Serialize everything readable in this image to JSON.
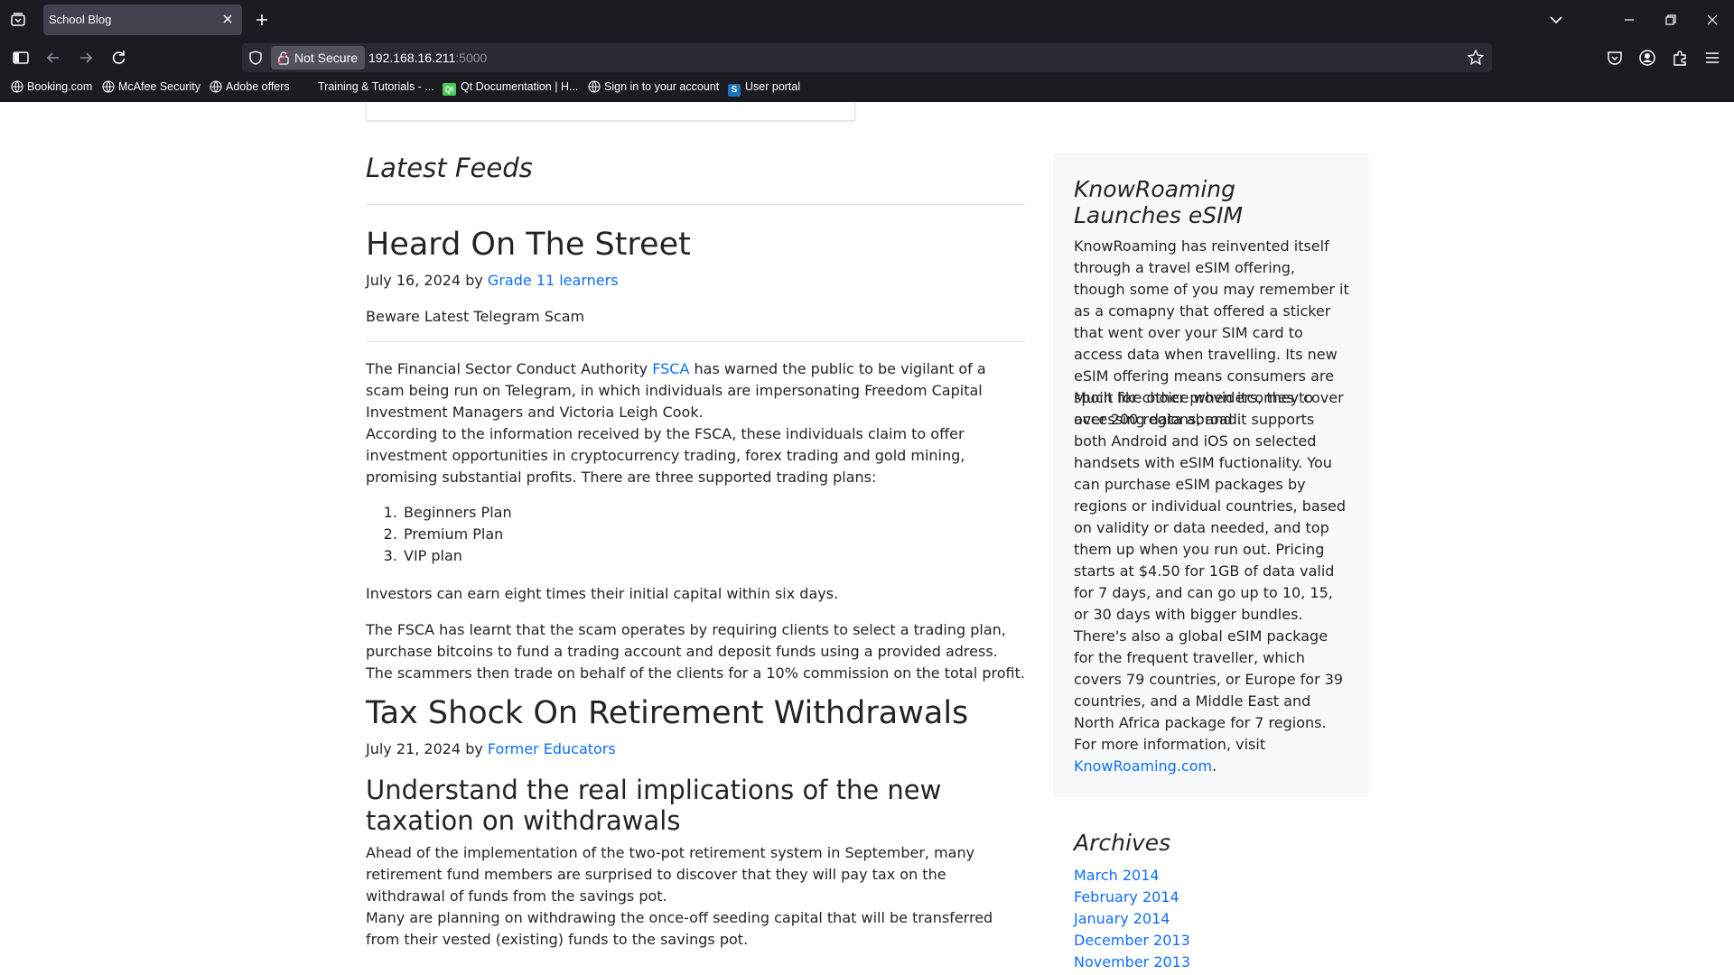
{
  "browser": {
    "tab_title": "School Blog",
    "security_label": "Not Secure",
    "url_host": "192.168.16.211",
    "url_port": ":5000",
    "bookmarks": [
      {
        "label": "Booking.com",
        "icon": "globe-icon"
      },
      {
        "label": "McAfee Security",
        "icon": "globe-icon"
      },
      {
        "label": "Adobe offers",
        "icon": "globe-icon"
      },
      {
        "label": "Training & Tutorials - ...",
        "icon": "none"
      },
      {
        "label": "Qt Documentation | H...",
        "icon": "qt-icon"
      },
      {
        "label": "Sign in to your account",
        "icon": "globe-icon"
      },
      {
        "label": "User portal",
        "icon": "s-icon"
      }
    ]
  },
  "main": {
    "feeds_title": "Latest Feeds",
    "posts": [
      {
        "title": "Heard On The Street",
        "date": "July 16, 2024",
        "by": "by",
        "author": "Grade 11 learners",
        "subtitle": "Beware Latest Telegram Scam",
        "p1_before": "The Financial Sector Conduct Authority ",
        "p1_link": "FSCA",
        "p1_after": " has warned the public to be vigilant of a scam being run on Telegram, in which individuals are impersonating Freedom Capital Investment Managers and Victoria Leigh Cook.",
        "p2": "According to the information received by the FSCA, these individuals claim to offer investment opportunities in cryptocurrency trading, forex trading and gold mining, promising substantial profits. There are three supported trading plans:",
        "plans": [
          "Beginners Plan",
          "Premium Plan",
          "VIP plan"
        ],
        "p3": "Investors can earn eight times their initial capital within six days.",
        "p4": "The FSCA has learnt that the scam operates by requiring clients to select a trading plan, purchase bitcoins to fund a trading account and deposit funds using a provided adress.",
        "p5": "The scammers then trade on behalf of the clients for a 10% commission on the total profit."
      },
      {
        "title": "Tax Shock On Retirement Withdrawals",
        "date": "July 21, 2024",
        "by": "by",
        "author": "Former Educators",
        "subtitle": "Understand the real implications of the new taxation on withdrawals",
        "p1": "Ahead of the implementation of the two-pot retirement system in September, many retirement fund members are surprised to discover that they will pay tax on the withdrawal of funds from the savings pot.",
        "p2": "Many are planning on withdrawing the once-off seeding capital that will be transferred from their vested (existing) funds to the savings pot."
      }
    ]
  },
  "sidebar": {
    "title": "KnowRoaming Launches eSIM",
    "p1": "KnowRoaming has reinvented itself through a travel eSIM offering, though some of you may remember it as a comapny that offered a sticker that went over your SIM card to access data when travelling. Its new eSIM offering means consumers are spoilt for choice when itcomes to accessing data abroad.",
    "p2": "Much like other providers, they cover over 200 regions, and it supports both Android and iOS on selected handsets with eSIM fuctionality. You can purchase eSIM packages by regions or individual countries, based on validity or data needed, and top them up when you run out. Pricing starts at $4.50 for 1GB of data valid for 7 days, and can go up to 10, 15, or 30 days with bigger bundles. There's also a global eSIM package for the frequent traveller, which covers 79 countries, or Europe for 39 countries, and a Middle East and North Africa package for 7 regions.",
    "p3": "For more information, visit",
    "link": "KnowRoaming.com",
    "link_suffix": "."
  },
  "archives": {
    "title": "Archives",
    "items": [
      "March 2014",
      "February 2014",
      "January 2014",
      "December 2013",
      "November 2013"
    ]
  }
}
